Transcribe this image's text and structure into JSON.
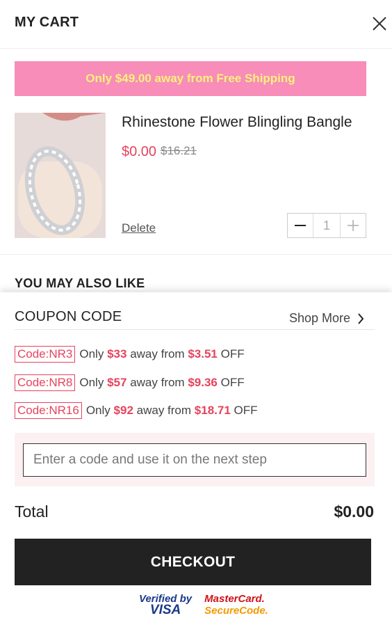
{
  "header": {
    "title": "MY CART"
  },
  "shipping_banner": "Only $49.00 away from Free Shipping",
  "cart_item": {
    "name": "Rhinestone Flower Blingling Bangle",
    "price": "$0.00",
    "original_price": "$16.21",
    "delete_label": "Delete",
    "quantity": "1"
  },
  "also_like": {
    "title": "YOU MAY ALSO LIKE"
  },
  "coupon": {
    "title": "COUPON CODE",
    "shop_more": "Shop More",
    "codes": [
      {
        "code": "Code:NR3",
        "pre": "Only",
        "amount": "$33",
        "mid": "away from",
        "discount": "$3.51",
        "post": "OFF"
      },
      {
        "code": "Code:NR8",
        "pre": "Only",
        "amount": "$57",
        "mid": "away from",
        "discount": "$9.36",
        "post": "OFF"
      },
      {
        "code": "Code:NR16",
        "pre": "Only",
        "amount": "$92",
        "mid": "away from",
        "discount": "$18.71",
        "post": "OFF"
      }
    ],
    "input_placeholder": "Enter a code and use it on the next step"
  },
  "total": {
    "label": "Total",
    "value": "$0.00"
  },
  "checkout_label": "CHECKOUT",
  "badges": {
    "visa_line1": "Verified by",
    "visa_line2": "VISA",
    "mc_line1": "MasterCard.",
    "mc_line2": "SecureCode."
  },
  "colors": {
    "accent": "#e5435d",
    "banner_bg": "#f78db8",
    "banner_text": "#fbf27b",
    "checkout_bg": "#222222"
  }
}
